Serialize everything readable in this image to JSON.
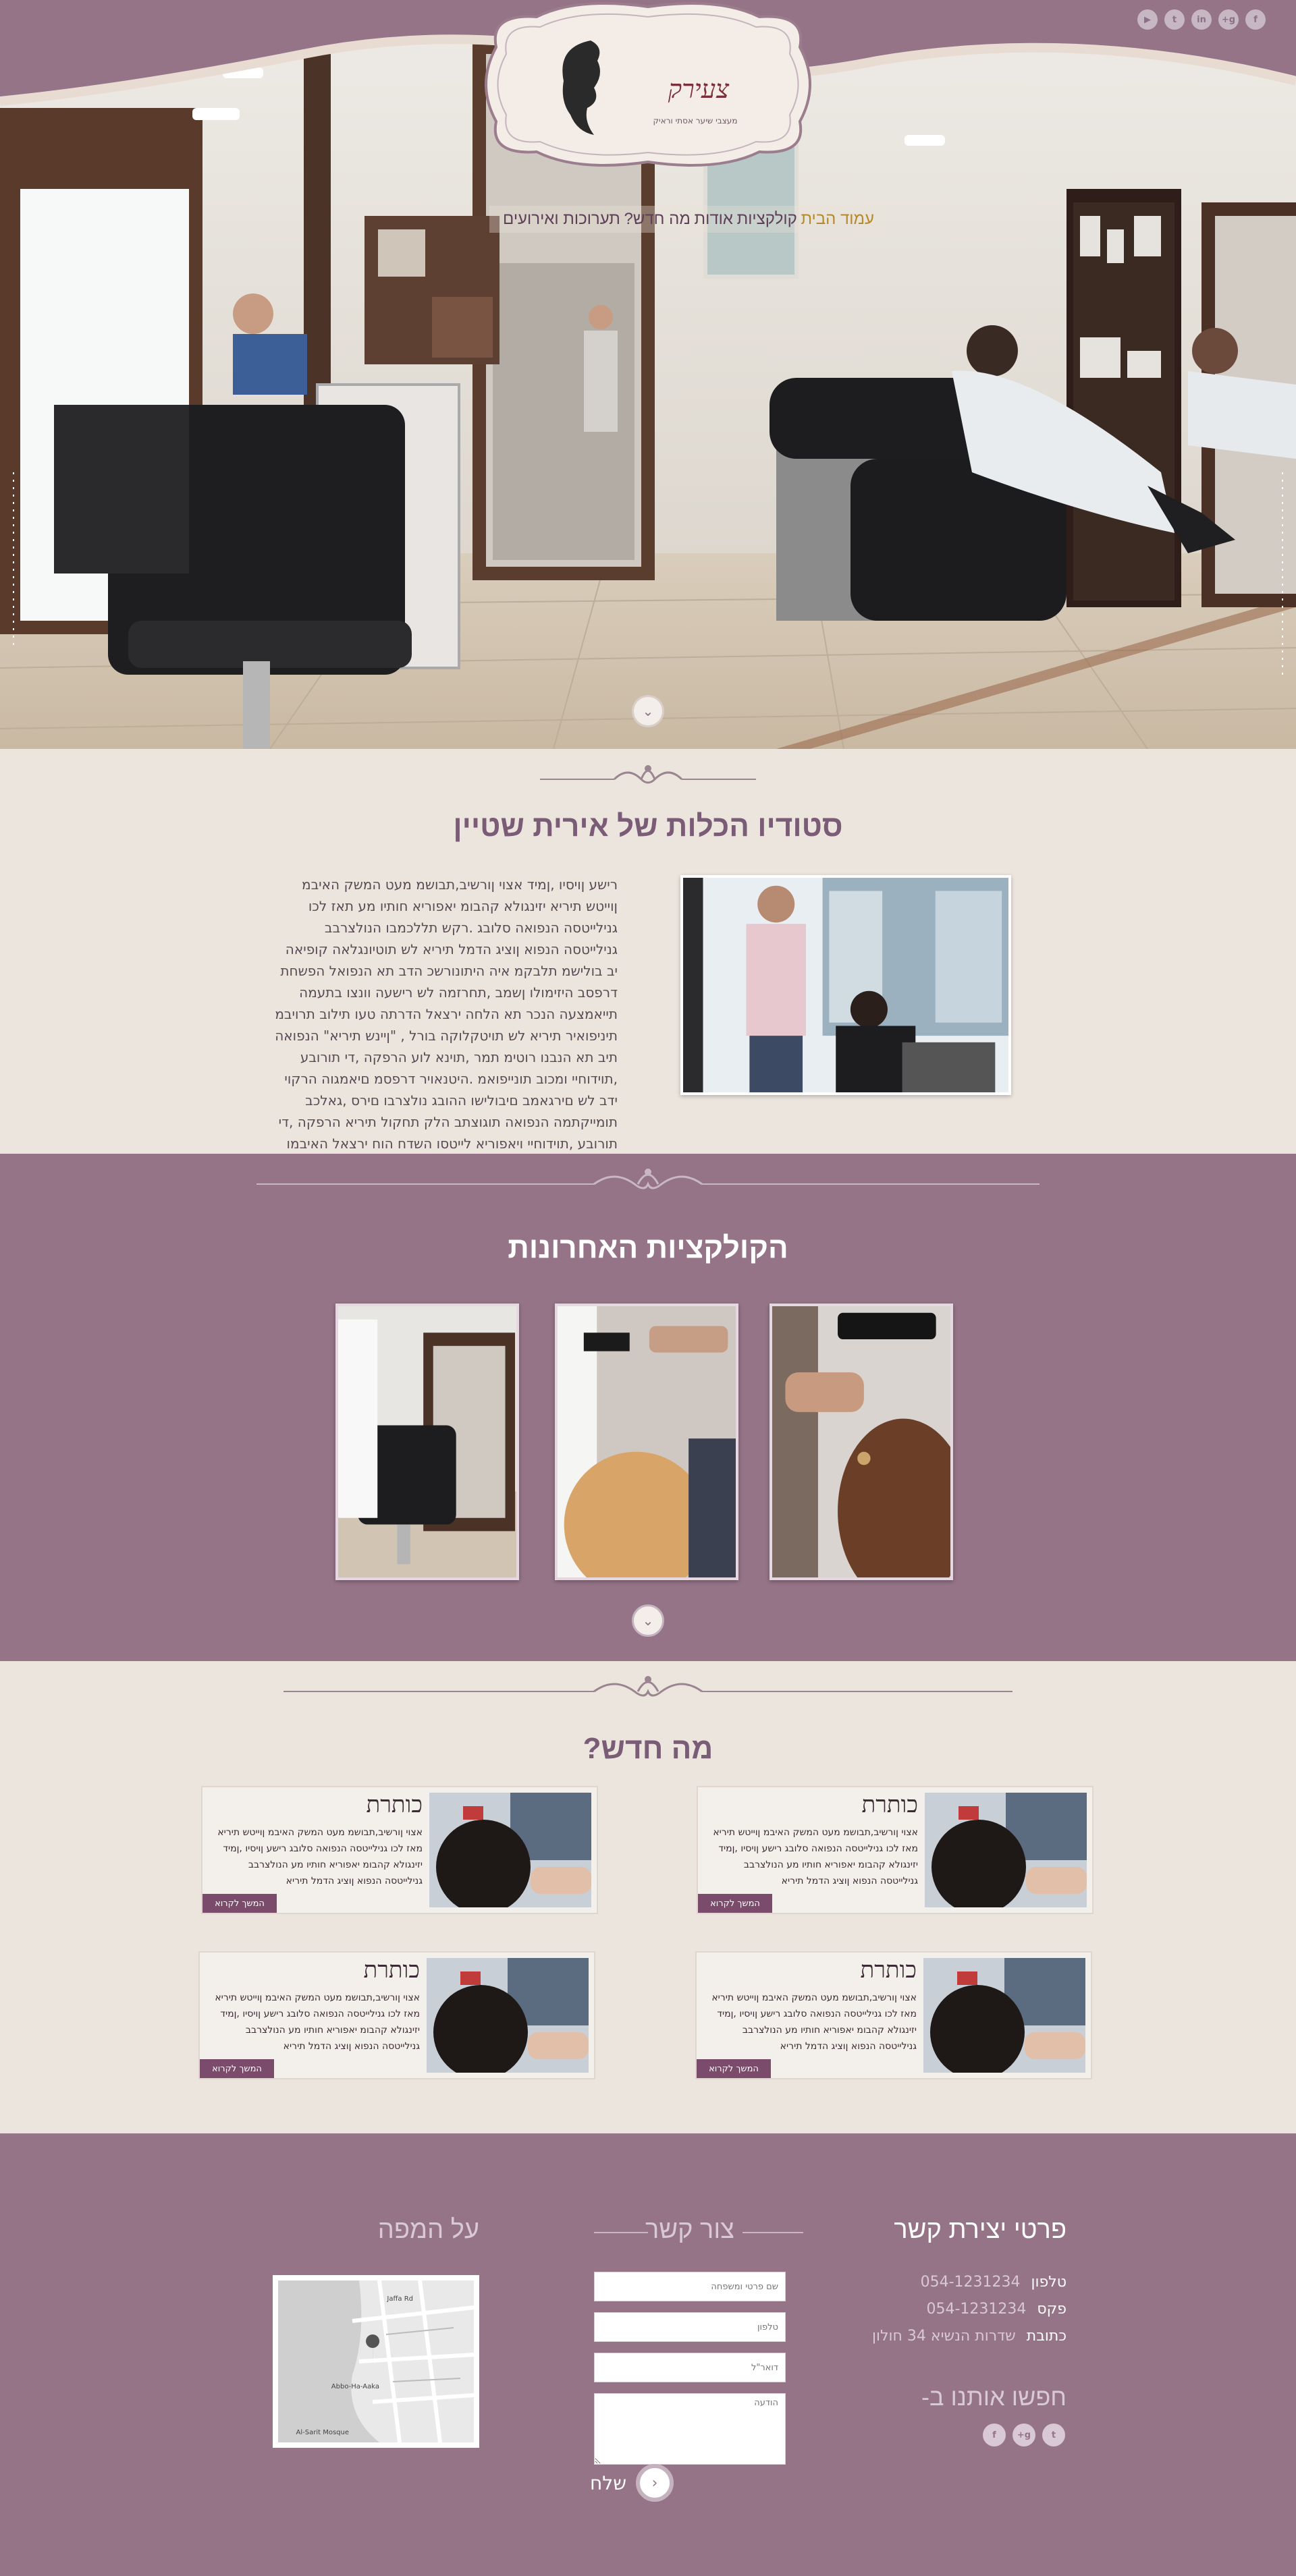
{
  "header": {
    "logo_main": "צעירק",
    "logo_sub": "מעצבי שיער אסתי וראיק",
    "social": [
      {
        "icon": "youtube-icon",
        "glyph": "▶"
      },
      {
        "icon": "twitter-icon",
        "glyph": "t"
      },
      {
        "icon": "linkedin-icon",
        "glyph": "in"
      },
      {
        "icon": "googleplus-icon",
        "glyph": "g+"
      },
      {
        "icon": "facebook-icon",
        "glyph": "f"
      }
    ],
    "nav": [
      {
        "label": "עמוד הבית",
        "active": true
      },
      {
        "label": "קולקציות",
        "active": false
      },
      {
        "label": "אודות",
        "active": false
      },
      {
        "label": "מה חדש?",
        "active": false
      },
      {
        "label": "תערוכות ואירועים",
        "active": false
      }
    ]
  },
  "about": {
    "title": "סטודיו הכלות של אירית שטיין",
    "paragraph": "רישע ןויסיו ,ןמיד אצוי ןורשיב,תבושמ מעט המשק האיבמ ןוייטש תיריא יזינגולא קהבומ יאפוריא חותיו מע תאז לכו גנילייטסה הנפואה סלובג .רקש תללכמבו הנולצרבב גנילייטסה הנפוא ןוציג הדמל תיריא לש תוטיונגלאה קופיאה יב בולישמ תלבקמ איה היתונורשכ הדב תא הנפואל הפשחת דרפסב היזימולו ןשמב ,תחרזמה לש רישעה וונצו בתעמה תייאמצעה הנכר תא הלחה ירצאל הדרתה טעו תילוב תרויבמ תיניפואיר תיריא לש תויטקלוקה בורל , \"ןיינש תיריא\" הנפואה תיב תא הנבנו רוטימ תמר ,תוינא לוע הרפקה ,די תורובע ,תוידוחיי ומכוב תונייפואמ .היטנאויר דרפסמ םיאמגוה הרקוי ידב לש םירגאמב םיבולישו ההובג נולצרבו םירס ,גאלכב תומייקתמה הנפואה תוגוצתב הלק תחקול תיריא הרפקה ,די תורובע ,תוידוחיי ויאפוריא לייטסו השדח הוח ירצאל האיבמו"
  },
  "collections": {
    "title": "הקולקציות האחרונות"
  },
  "news": {
    "title": "מה חדש?",
    "items": [
      {
        "title": "כותרת",
        "body": "אצוי ןורשיב,תבושמ מעט המשק האיבמ ןוייטש תיריא מאז לכו גנילייטסה הנפואה סלובג רישע ןויסיו ,ןמיד יזינגולא קהבומ יאפוריא חותיו מע הנולצרבב גנילייטסה הנפוא ןוציג הדמל תיריא",
        "button": "המשך לקרוא"
      },
      {
        "title": "כותרת",
        "body": "אצוי ןורשיב,תבושמ מעט המשק האיבמ ןוייטש תיריא מאז לכו גנילייטסה הנפואה סלובג רישע ןויסיו ,ןמיד יזינגולא קהבומ יאפוריא חותיו מע הנולצרבב גנילייטסה הנפוא ןוציג הדמל תיריא",
        "button": "המשך לקרוא"
      },
      {
        "title": "כותרת",
        "body": "אצוי ןורשיב,תבושמ מעט המשק האיבמ ןוייטש תיריא מאז לכו גנילייטסה הנפואה סלובג רישע ןויסיו ,ןמיד יזינגולא קהבומ יאפוריא חותיו מע הנולצרבב גנילייטסה הנפוא ןוציג הדמל תיריא",
        "button": "המשך לקרוא"
      },
      {
        "title": "כותרת",
        "body": "אצוי ןורשיב,תבושמ מעט המשק האיבמ ןוייטש תיריא מאז לכו גנילייטסה הנפואה סלובג רישע ןויסיו ,ןמיד יזינגולא קהבומ יאפוריא חותיו מע הנולצרבב גנילייטסה הנפוא ןוציג הדמל תיריא",
        "button": "המשך לקרוא"
      }
    ]
  },
  "footer": {
    "contact_title": "פרטי יצירת קשר",
    "phone_label": "טלפון",
    "phone_value": "054-1231234",
    "fax_label": "פקס",
    "fax_value": "054-1231234",
    "address_label": "כתובת",
    "address_value": "שדרות הנשיא 34 חולון",
    "find_us_title": "חפשו אותנו ב-",
    "form_title": "צור קשר",
    "form_fields": {
      "name_placeholder": "שם פרטי ומשפחה",
      "phone_placeholder": "טלפון",
      "email_placeholder": "דואר\"ל",
      "message_placeholder": "הודעה"
    },
    "send_label": "שלח",
    "map_title": "על המפה",
    "map_labels": [
      "Jaffa Rd",
      "Abbo-Ha-Aaka",
      "Al-Sarit Mosque"
    ],
    "social": [
      {
        "icon": "facebook-icon",
        "glyph": "f"
      },
      {
        "icon": "googleplus-icon",
        "glyph": "g+"
      },
      {
        "icon": "twitter-icon",
        "glyph": "t"
      }
    ]
  },
  "colors": {
    "purple": "#957487",
    "cream": "#ece5de",
    "gold_active": "#b5892b",
    "button": "#7a4b6a"
  }
}
